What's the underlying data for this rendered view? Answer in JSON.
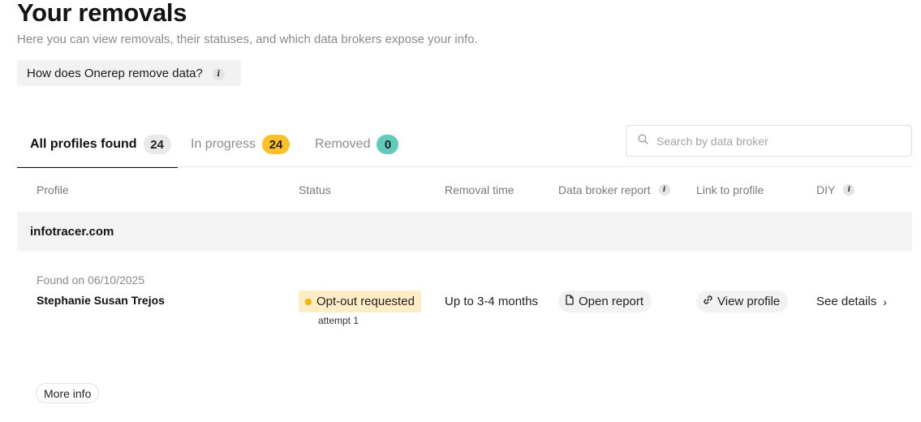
{
  "header": {
    "title": "Your removals",
    "subtitle": "Here you can view removals, their statuses, and which data brokers expose your info.",
    "how_button": "How does Onerep remove data?"
  },
  "tabs": [
    {
      "label": "All profiles found",
      "count": "24",
      "active": true
    },
    {
      "label": "In progress",
      "count": "24",
      "active": false
    },
    {
      "label": "Removed",
      "count": "0",
      "active": false
    }
  ],
  "search": {
    "placeholder": "Search by data broker"
  },
  "table": {
    "columns": {
      "profile": "Profile",
      "status": "Status",
      "removal_time": "Removal time",
      "report": "Data broker report",
      "link": "Link to profile",
      "diy": "DIY"
    },
    "groups": [
      {
        "broker": "infotracer.com",
        "rows": [
          {
            "found_on": "Found on 06/10/2025",
            "name": "Stephanie Susan Trejos",
            "status": "Opt-out requested",
            "attempt": "attempt 1",
            "removal_time": "Up to 3-4 months",
            "report_button": "Open report",
            "profile_button": "View profile",
            "diy_link": "See details"
          }
        ]
      }
    ]
  },
  "footer": {
    "more_info": "More info"
  },
  "colors": {
    "status_bg": "#fdecc4",
    "status_dot": "#f5b400",
    "count_in_progress": "#fcc223",
    "count_removed": "#5fcbbc"
  },
  "icons": {
    "info": "info-icon",
    "search": "search-icon",
    "report": "document-icon",
    "link": "link-icon",
    "chevron": "chevron-right-icon"
  }
}
